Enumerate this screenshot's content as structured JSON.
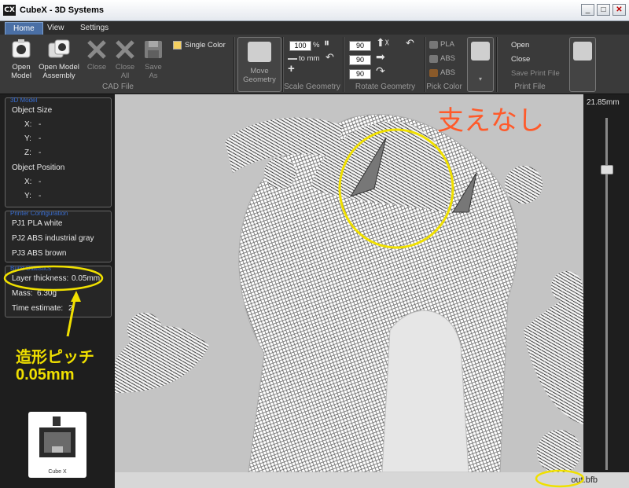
{
  "window": {
    "title": "CubeX - 3D Systems",
    "logo": "CX",
    "minimize": "_",
    "maximize": "□",
    "close": "✕"
  },
  "tabs": [
    "Home",
    "View",
    "Settings"
  ],
  "cad_file": {
    "group_label": "CAD File",
    "open_model": "Open\nModel",
    "open_assembly": "Open Model\nAssembly",
    "close": "Close",
    "close_all": "Close\nAll",
    "save_as": "Save\nAs",
    "single_color": "Single Color"
  },
  "move_geometry": {
    "label": "Move\nGeometry"
  },
  "scale_geometry": {
    "group_label": "Scale Geometry",
    "value": "100",
    "unit": "%",
    "to_mm": "to mm"
  },
  "rotate_geometry": {
    "group_label": "Rotate Geometry",
    "values": [
      "90",
      "90",
      "90"
    ]
  },
  "pick_color": {
    "group_label": "Pick Color",
    "items": [
      "PLA",
      "ABS",
      "ABS"
    ]
  },
  "print_file": {
    "group_label": "Print File",
    "open": "Open",
    "close": "Close",
    "save": "Save Print File"
  },
  "object_panel": {
    "header": "3D Model",
    "size_title": "Object Size",
    "size_rows": [
      {
        "axis": "X:",
        "value": "-"
      },
      {
        "axis": "Y:",
        "value": "-"
      },
      {
        "axis": "Z:",
        "value": "-"
      }
    ],
    "position_title": "Object Position",
    "position_rows": [
      {
        "axis": "X:",
        "value": "-"
      },
      {
        "axis": "Y:",
        "value": "-"
      }
    ]
  },
  "printer_panel": {
    "header": "Printer Configuration",
    "jets": [
      "PJ1 PLA white",
      "PJ2 ABS industrial gray",
      "PJ3 ABS brown"
    ]
  },
  "build_panel": {
    "header": "Build Statistics",
    "layer_thickness_label": "Layer thickness:",
    "layer_thickness_value": "0.05mm",
    "mass_label": "Mass:",
    "mass_value": "6.30g",
    "time_label": "Time estimate:",
    "time_value": "2"
  },
  "printer_card": {
    "label": "Cube X"
  },
  "annotations": {
    "support_note": "支えなし",
    "pitch_note_line1": "造形ピッチ",
    "pitch_note_line2": "0.05mm",
    "highlight_color": "#f0e000",
    "support_color": "#ff5a2a"
  },
  "z_slider": {
    "value_label": "21.85mm"
  },
  "status": {
    "filename": "out.bfb"
  }
}
